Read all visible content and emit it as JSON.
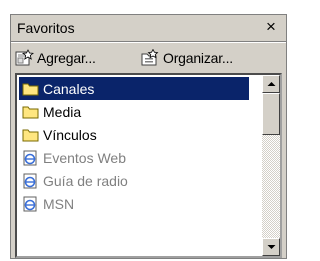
{
  "panel": {
    "title": "Favoritos",
    "close_symbol": "×"
  },
  "toolbar": {
    "add_label": "Agregar...",
    "organize_label": "Organizar..."
  },
  "items": [
    {
      "label": "Canales",
      "icon": "folder-icon",
      "selected": true
    },
    {
      "label": "Media",
      "icon": "folder-icon",
      "selected": false
    },
    {
      "label": "Vínculos",
      "icon": "folder-icon",
      "selected": false
    },
    {
      "label": "Eventos Web",
      "icon": "web-link-icon",
      "selected": false
    },
    {
      "label": "Guía de radio",
      "icon": "web-link-icon",
      "selected": false
    },
    {
      "label": "MSN",
      "icon": "web-link-icon",
      "selected": false
    }
  ],
  "colors": {
    "selection": "#0a246a",
    "folder": "#ffe680",
    "link_text": "#808080",
    "face": "#d4d0c8"
  }
}
